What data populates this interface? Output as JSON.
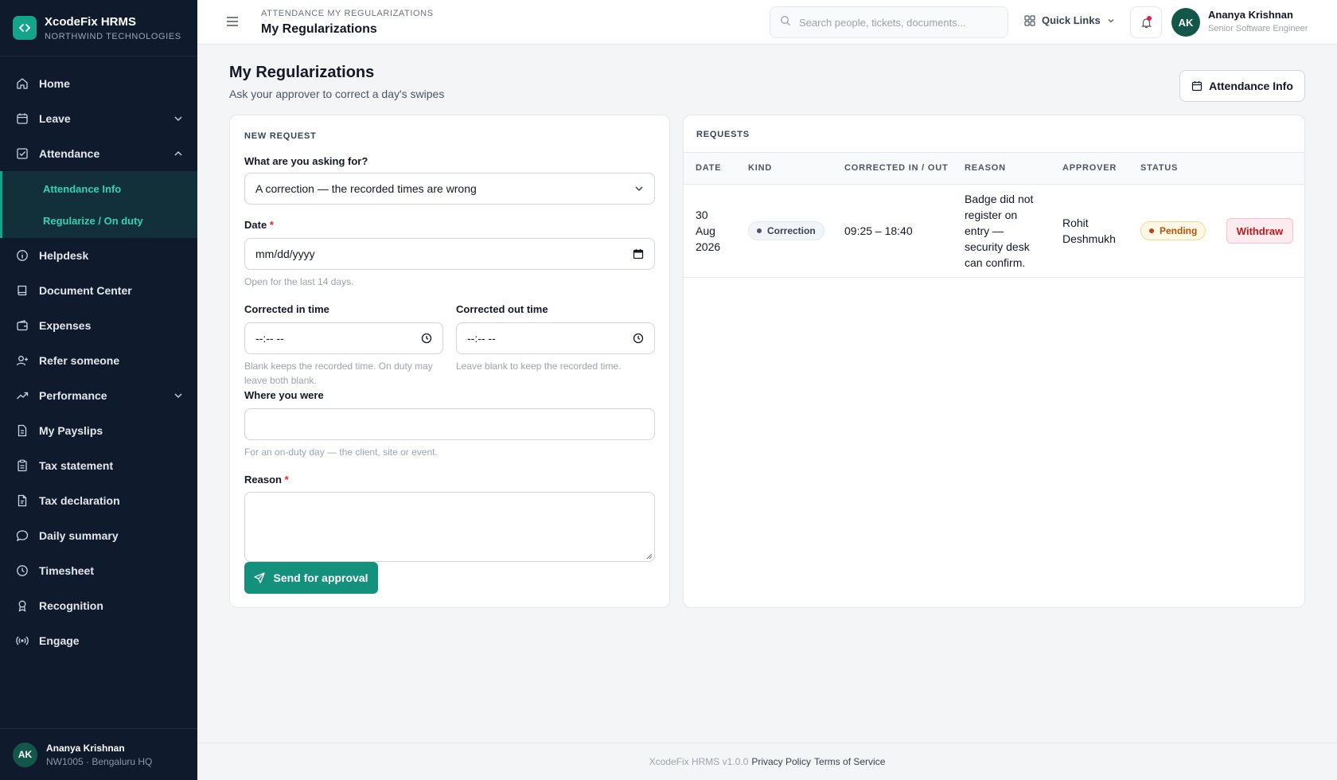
{
  "brand": {
    "name": "XcodeFix HRMS",
    "org": "NORTHWIND TECHNOLOGIES",
    "accent": "#14a38b"
  },
  "sidebar": {
    "items": [
      {
        "label": "Home",
        "icon": "home-icon"
      },
      {
        "label": "Leave",
        "icon": "calendar-icon"
      },
      {
        "label": "Attendance",
        "icon": "checkbox-icon"
      },
      {
        "label": "Helpdesk",
        "icon": "info-icon"
      },
      {
        "label": "Document Center",
        "icon": "book-icon"
      },
      {
        "label": "Expenses",
        "icon": "wallet-icon"
      },
      {
        "label": "Refer someone",
        "icon": "user-plus-icon"
      },
      {
        "label": "Performance",
        "icon": "trend-icon"
      },
      {
        "label": "My Payslips",
        "icon": "file-icon"
      },
      {
        "label": "Tax statement",
        "icon": "clipboard-icon"
      },
      {
        "label": "Tax declaration",
        "icon": "file-text-icon"
      },
      {
        "label": "Daily summary",
        "icon": "chat-icon"
      },
      {
        "label": "Timesheet",
        "icon": "clock-icon"
      },
      {
        "label": "Recognition",
        "icon": "award-icon"
      },
      {
        "label": "Engage",
        "icon": "broadcast-icon"
      }
    ],
    "attendance_sub": [
      {
        "label": "Attendance Info"
      },
      {
        "label": "Regularize / On duty"
      }
    ],
    "footer": {
      "initials": "AK",
      "name": "Ananya Krishnan",
      "meta": "NW1005 · Bengaluru HQ"
    }
  },
  "topbar": {
    "breadcrumb": "ATTENDANCE MY REGULARIZATIONS",
    "title": "My Regularizations",
    "search_placeholder": "Search people, tickets, documents...",
    "quick_links": "Quick Links",
    "user": {
      "initials": "AK",
      "name": "Ananya Krishnan",
      "role": "Senior Software Engineer"
    }
  },
  "main": {
    "title": "My Regularizations",
    "subtitle": "Ask your approver to correct a day's swipes",
    "attendance_info_button": "Attendance Info"
  },
  "form": {
    "caption": "NEW REQUEST",
    "asking_label": "What are you asking for?",
    "asking_value": "A correction — the recorded times are wrong",
    "date_label": "Date",
    "required_mark": "*",
    "date_placeholder": "mm/dd/yyyy",
    "date_hint": "Open for the last 14 days.",
    "in_label": "Corrected in time",
    "in_placeholder": "--:-- --",
    "in_hint": "Blank keeps the recorded time. On duty may leave both blank.",
    "out_label": "Corrected out time",
    "out_placeholder": "--:-- --",
    "out_hint": "Leave blank to keep the recorded time.",
    "where_label": "Where you were",
    "where_value": "",
    "where_hint": "For an on-duty day — the client, site or event.",
    "reason_label": "Reason",
    "reason_value": "",
    "submit": "Send for approval"
  },
  "requests": {
    "caption": "REQUESTS",
    "columns": [
      "DATE",
      "KIND",
      "CORRECTED IN / OUT",
      "REASON",
      "APPROVER",
      "STATUS"
    ],
    "rows": [
      {
        "date_lines": [
          "30",
          "Aug",
          "2026"
        ],
        "kind": "Correction",
        "in_out": "09:25 – 18:40",
        "reason_lines": [
          "Badge did not",
          "register on",
          "entry —",
          "security desk",
          "can confirm."
        ],
        "approver_lines": [
          "Rohit",
          "Deshmukh"
        ],
        "status": "Pending",
        "action": "Withdraw"
      }
    ]
  },
  "footer": {
    "version": "XcodeFix HRMS v1.0.0",
    "privacy": "Privacy Policy",
    "terms": "Terms of Service"
  }
}
